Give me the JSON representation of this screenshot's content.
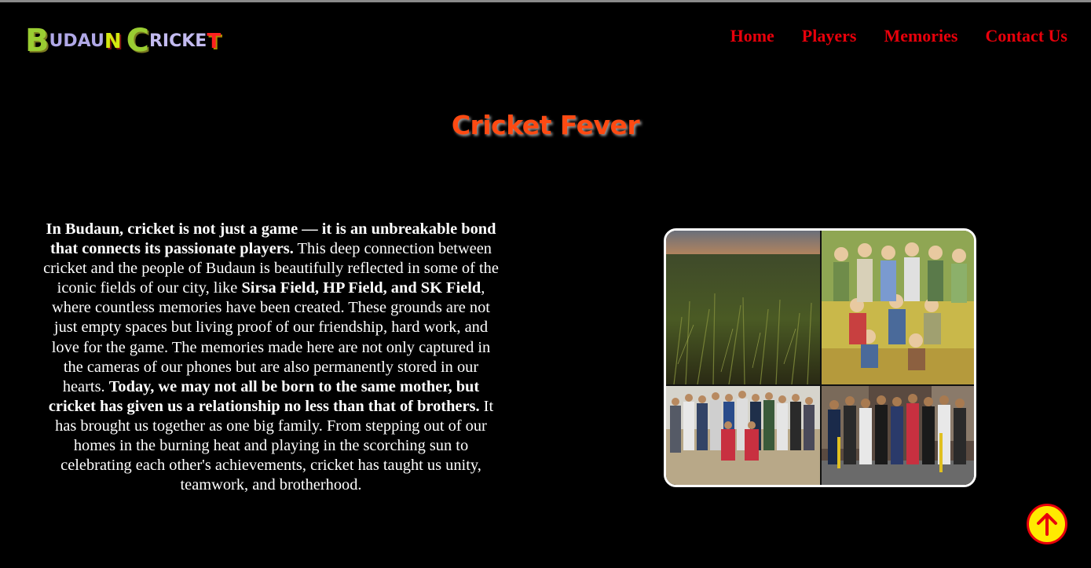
{
  "logo": {
    "parts": [
      "B",
      "UDAU",
      "N",
      "C",
      "RICKE",
      "T"
    ],
    "colors": {
      "primary": "#9acd32",
      "secondary": "#c3bbf0",
      "accent_n": "#d4e810",
      "accent_t": "#ff2020"
    }
  },
  "nav": {
    "items": [
      {
        "label": "Home"
      },
      {
        "label": "Players"
      },
      {
        "label": "Memories"
      },
      {
        "label": "Contact Us"
      }
    ],
    "color": "#e8000b"
  },
  "main": {
    "title": "Cricket Fever",
    "title_color": "#ff4a12",
    "paragraph": [
      {
        "text": "In Budaun, cricket is not just a game — it is an unbreakable bond that connects its passionate players.",
        "bold": true
      },
      {
        "text": " This deep connection between cricket and the people of Budaun is beautifully reflected in some of the iconic fields of our city, like ",
        "bold": false
      },
      {
        "text": "Sirsa Field, HP Field, and SK Field",
        "bold": true
      },
      {
        "text": ", where countless memories have been created. These grounds are not just empty spaces but living proof of our friendship, hard work, and love for the game. The memories made here are not only captured in the cameras of our phones but are also permanently stored in our hearts. ",
        "bold": false
      },
      {
        "text": "Today, we may not all be born to the same mother, but cricket has given us a relationship no less than that of brothers.",
        "bold": true
      },
      {
        "text": " It has brought us together as one big family. From stepping out of our homes in the burning heat and playing in the scorching sun to celebrating each other's achievements, cricket has taught us unity, teamwork, and brotherhood.",
        "bold": false
      }
    ]
  },
  "collage": {
    "tiles": [
      {
        "name": "grass-field-photo"
      },
      {
        "name": "team-illustration"
      },
      {
        "name": "team-photo-ground"
      },
      {
        "name": "team-photo-street"
      }
    ]
  },
  "back_to_top": {
    "icon": "arrow-up-icon",
    "bg": "#ffea00",
    "border": "#e8000b"
  }
}
